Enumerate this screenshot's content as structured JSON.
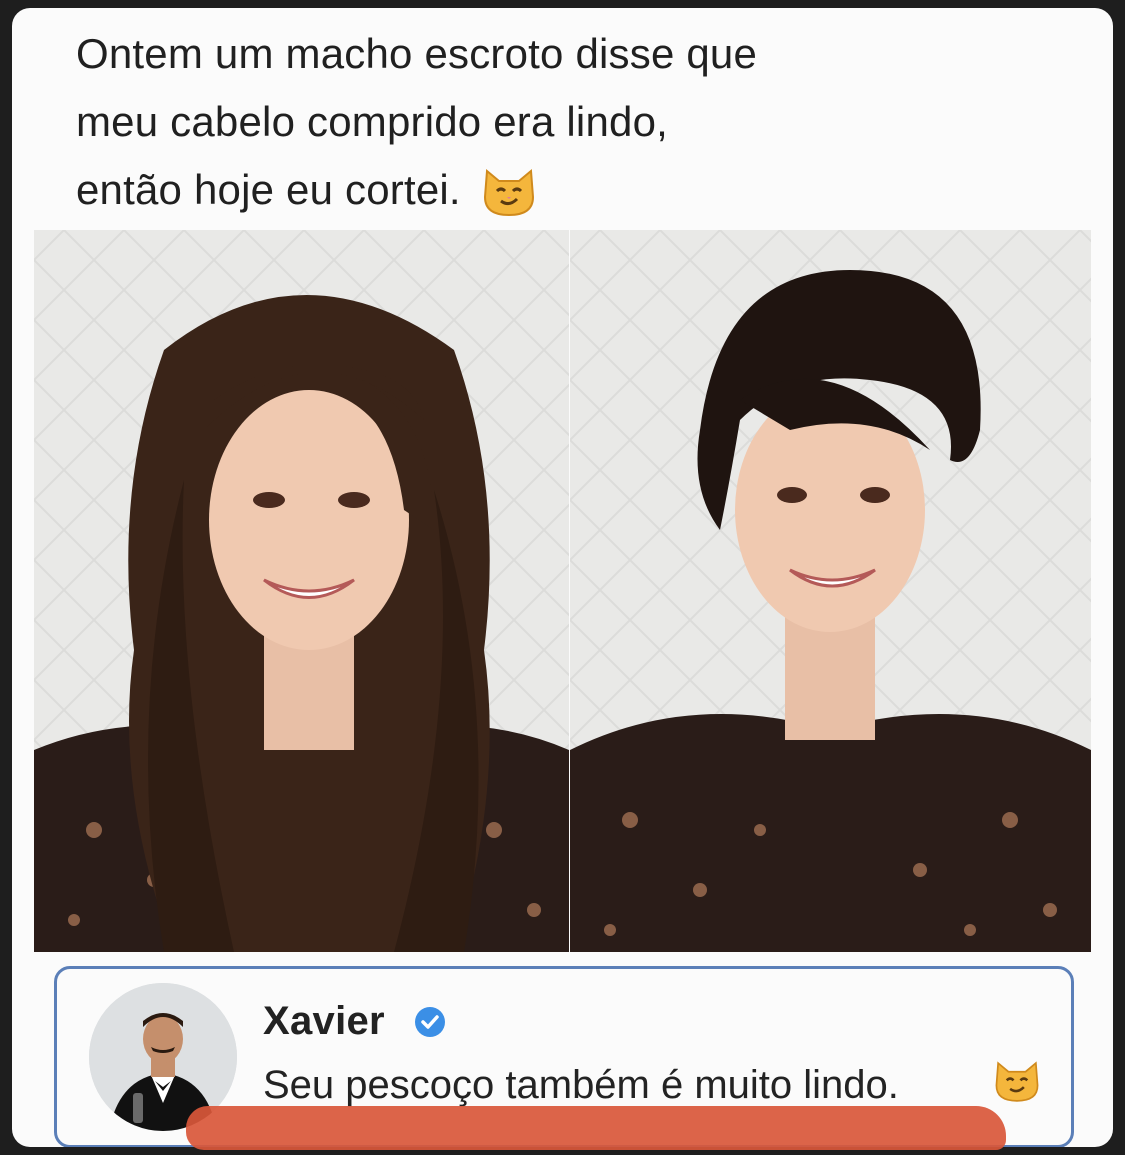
{
  "post": {
    "line1": "Ontem um macho escroto disse que",
    "line2": "meu cabelo comprido era lindo,",
    "line3": "então hoje eu cortei.",
    "emoji": "smirking-cat-emoji"
  },
  "photos": {
    "left": "before-long-hair-photo",
    "right": "after-short-hair-photo"
  },
  "comment": {
    "author": "Xavier",
    "verified": true,
    "text": "Seu pescoço também é muito lindo.",
    "emoji": "smirking-cat-emoji"
  },
  "colors": {
    "accent_border": "#5b7fb8",
    "verified_badge": "#3b8fe6",
    "highlight": "#d9573a"
  }
}
